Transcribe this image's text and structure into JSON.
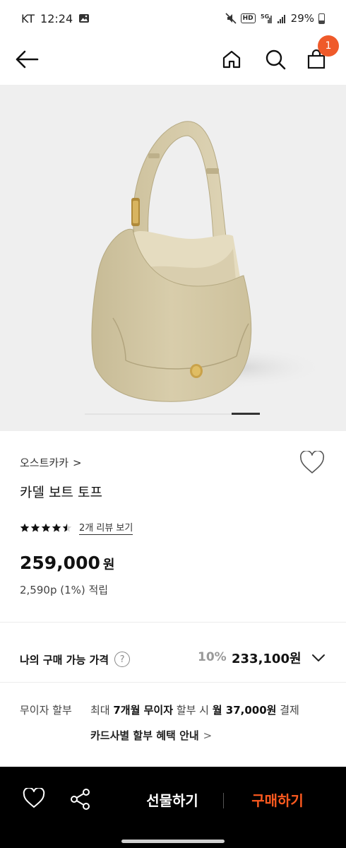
{
  "status_bar": {
    "carrier": "KT",
    "time": "12:24",
    "battery": "29%",
    "icons": [
      "gallery-icon",
      "mute-icon",
      "hd-icon",
      "5g-icon",
      "signal-icon",
      "battery-icon"
    ]
  },
  "header": {
    "cart_count": "1",
    "icons": [
      "back-arrow-icon",
      "home-icon",
      "search-icon",
      "cart-icon"
    ],
    "accent_color": "#ef5a2a"
  },
  "product": {
    "image_alt": "product-photo",
    "brand": "오스트카카",
    "brand_chevron": ">",
    "name": "카델 보트 토프",
    "rating": 4.5,
    "review_link": "2개 리뷰 보기",
    "price": "259,000",
    "price_unit": "원",
    "points": "2,590p (1%) 적립",
    "carousel_position": 0.9
  },
  "my_price": {
    "label": "나의 구매 가능 가격",
    "help": "?",
    "discount": "10%",
    "price": "233,100원"
  },
  "installment": {
    "label": "무이자 할부",
    "text_prefix": "최대 ",
    "months": "7개월 무이자",
    "text_middle": " 할부 시 ",
    "monthly": "월 37,000원",
    "text_suffix": " 결제",
    "card_link": "카드사별 할부 혜택 안내",
    "card_chevron": ">"
  },
  "bottom_bar": {
    "gift_label": "선물하기",
    "buy_label": "구매하기",
    "buy_color": "#ff5a1f"
  }
}
